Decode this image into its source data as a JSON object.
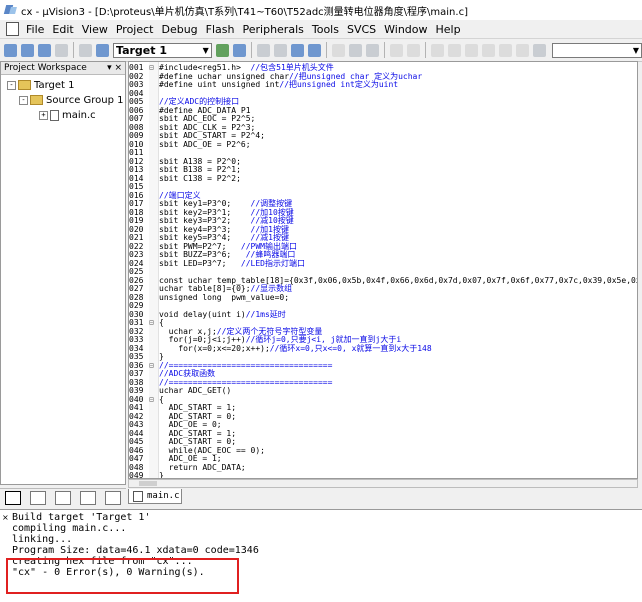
{
  "window": {
    "title": "cx - µVision3 - [D:\\proteus\\单片机仿真\\T系列\\T41~T60\\T52adc测量转电位器角度\\程序\\main.c]"
  },
  "menu": [
    "File",
    "Edit",
    "View",
    "Project",
    "Debug",
    "Flash",
    "Peripherals",
    "Tools",
    "SVCS",
    "Window",
    "Help"
  ],
  "toolbar": {
    "target": "Target 1"
  },
  "workspace": {
    "title": "Project Workspace",
    "close": "▾ ×",
    "tree": [
      {
        "label": "Target 1",
        "level": 0,
        "toggle": "-"
      },
      {
        "label": "Source Group 1",
        "level": 1,
        "toggle": "-"
      },
      {
        "label": "main.c",
        "level": 2,
        "toggle": "+"
      }
    ]
  },
  "editor": {
    "file_tab": "main.c",
    "lines": [
      {
        "n": "001",
        "g": "⊟",
        "code": "#include<reg51.h>",
        "comment": "  //包含51单片机头文件"
      },
      {
        "n": "002",
        "g": "",
        "code": "#define uchar unsigned char",
        "comment": "//把unsigned char 定义为uchar"
      },
      {
        "n": "003",
        "g": "",
        "code": "#define uint unsigned int",
        "comment": "//把unsigned int定义为uint"
      },
      {
        "n": "004",
        "g": "",
        "code": "",
        "comment": ""
      },
      {
        "n": "005",
        "g": "",
        "code": "",
        "comment": "//定义ADC的控制接口"
      },
      {
        "n": "006",
        "g": "",
        "code": "#define ADC_DATA P1",
        "comment": ""
      },
      {
        "n": "007",
        "g": "",
        "code": "sbit ADC_EOC = P2^5;",
        "comment": ""
      },
      {
        "n": "008",
        "g": "",
        "code": "sbit ADC_CLK = P2^3;",
        "comment": ""
      },
      {
        "n": "009",
        "g": "",
        "code": "sbit ADC_START = P2^4;",
        "comment": ""
      },
      {
        "n": "010",
        "g": "",
        "code": "sbit ADC_OE = P2^6;",
        "comment": ""
      },
      {
        "n": "011",
        "g": "",
        "code": "",
        "comment": ""
      },
      {
        "n": "012",
        "g": "",
        "code": "sbit A138 = P2^0;",
        "comment": ""
      },
      {
        "n": "013",
        "g": "",
        "code": "sbit B138 = P2^1;",
        "comment": ""
      },
      {
        "n": "014",
        "g": "",
        "code": "sbit C138 = P2^2;",
        "comment": ""
      },
      {
        "n": "015",
        "g": "",
        "code": "",
        "comment": ""
      },
      {
        "n": "016",
        "g": "",
        "code": "",
        "comment": "//端口定义"
      },
      {
        "n": "017",
        "g": "",
        "code": "sbit key1=P3^0;",
        "comment": "    //调整按键"
      },
      {
        "n": "018",
        "g": "",
        "code": "sbit key2=P3^1;",
        "comment": "    //加10按键"
      },
      {
        "n": "019",
        "g": "",
        "code": "sbit key3=P3^2;",
        "comment": "    //减10按键"
      },
      {
        "n": "020",
        "g": "",
        "code": "sbit key4=P3^3;",
        "comment": "    //加1按键"
      },
      {
        "n": "021",
        "g": "",
        "code": "sbit key5=P3^4;",
        "comment": "    //减1按键"
      },
      {
        "n": "022",
        "g": "",
        "code": "sbit PWM=P2^7;",
        "comment": "   //PWM输出端口"
      },
      {
        "n": "023",
        "g": "",
        "code": "sbit BUZZ=P3^6;",
        "comment": "   //蜂鸣器端口"
      },
      {
        "n": "024",
        "g": "",
        "code": "sbit LED=P3^7;",
        "comment": "   //LED指示灯端口"
      },
      {
        "n": "025",
        "g": "",
        "code": "",
        "comment": ""
      },
      {
        "n": "026",
        "g": "",
        "code": "const uchar temp_table[18]={0x3f,0x06,0x5b,0x4f,0x66,0x6d,0x7d,0x07,0x7f,0x6f,0x77,0x7c,0x39,0x5e,0x79,",
        "comment": ""
      },
      {
        "n": "027",
        "g": "",
        "code": "uchar table[8]={0};",
        "comment": "//显示数组"
      },
      {
        "n": "028",
        "g": "",
        "code": "unsigned long  pwm_value=0;",
        "comment": ""
      },
      {
        "n": "029",
        "g": "",
        "code": "",
        "comment": ""
      },
      {
        "n": "030",
        "g": "",
        "code": "void delay(uint i)",
        "comment": "//1ms延时"
      },
      {
        "n": "031",
        "g": "⊟",
        "code": "{",
        "comment": ""
      },
      {
        "n": "032",
        "g": "",
        "code": "  uchar x,j;",
        "comment": "//定义两个无符号字符型变量"
      },
      {
        "n": "033",
        "g": "",
        "code": "  for(j=0;j<i;j++)",
        "comment": "//循环j=0,只要j<i, j就加一直到j大于i"
      },
      {
        "n": "034",
        "g": "",
        "code": "    for(x=0;x<=20;x++);",
        "comment": "//循环x=0,只x<=0, x就算一直到x大于148"
      },
      {
        "n": "035",
        "g": "",
        "code": "}",
        "comment": ""
      },
      {
        "n": "036",
        "g": "⊟",
        "code": "",
        "comment": "//=================================="
      },
      {
        "n": "037",
        "g": "",
        "code": "",
        "comment": "//ADC获取函数"
      },
      {
        "n": "038",
        "g": "",
        "code": "",
        "comment": "//=================================="
      },
      {
        "n": "039",
        "g": "",
        "code": "uchar ADC_GET()",
        "comment": ""
      },
      {
        "n": "040",
        "g": "⊟",
        "code": "{",
        "comment": ""
      },
      {
        "n": "041",
        "g": "",
        "code": "  ADC_START = 1;",
        "comment": ""
      },
      {
        "n": "042",
        "g": "",
        "code": "  ADC_START = 0;",
        "comment": ""
      },
      {
        "n": "043",
        "g": "",
        "code": "  ADC_OE = 0;",
        "comment": ""
      },
      {
        "n": "044",
        "g": "",
        "code": "  ADC_START = 1;",
        "comment": ""
      },
      {
        "n": "045",
        "g": "",
        "code": "  ADC_START = 0;",
        "comment": ""
      },
      {
        "n": "046",
        "g": "",
        "code": "  while(ADC_EOC == 0);",
        "comment": ""
      },
      {
        "n": "047",
        "g": "",
        "code": "  ADC_OE = 1;",
        "comment": ""
      },
      {
        "n": "048",
        "g": "",
        "code": "  return ADC_DATA;",
        "comment": ""
      },
      {
        "n": "049",
        "g": "",
        "code": "}",
        "comment": ""
      }
    ]
  },
  "output": {
    "marker": "×",
    "lines": [
      "Build target 'Target 1'",
      "compiling main.c...",
      "linking...",
      "Program Size: data=46.1 xdata=0 code=1346",
      "creating hex file from \"cx\"...",
      "\"cx\" - 0 Error(s), 0 Warning(s)."
    ]
  },
  "colors": {
    "comment": "#0a0ae6",
    "highlight": "#e02020"
  }
}
